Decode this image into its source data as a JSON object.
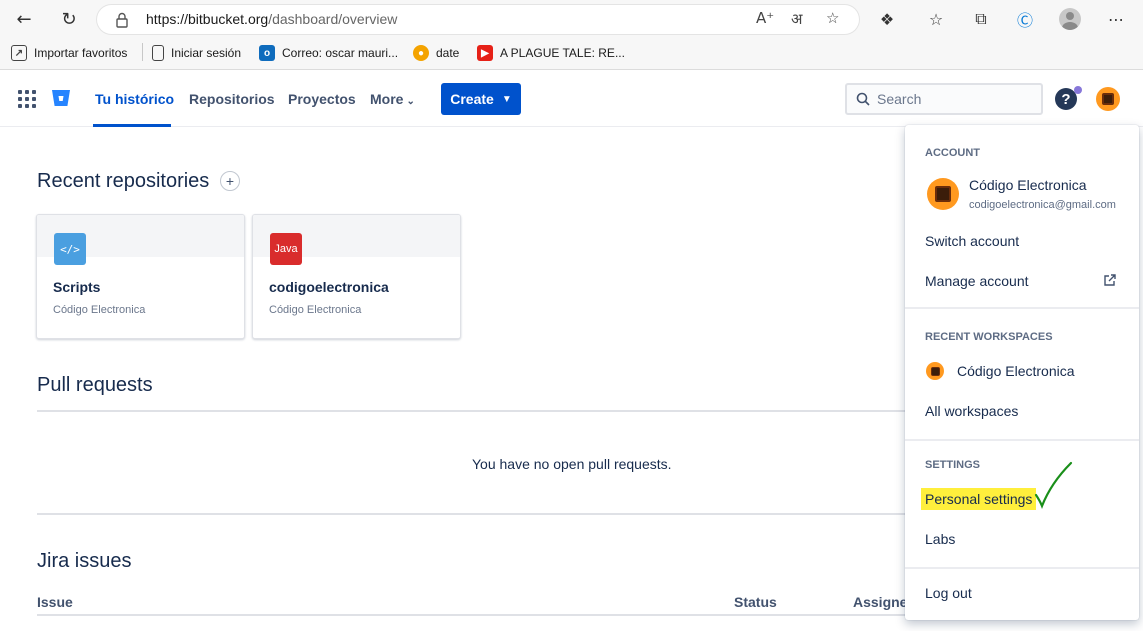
{
  "browser": {
    "url_main": "https://bitbucket.org",
    "url_path": "/dashboard/overview",
    "bookmarks": [
      {
        "label": "Importar favoritos",
        "icon": "import-icon"
      },
      {
        "label": "Iniciar sesión",
        "icon": "page-icon"
      },
      {
        "label": "Correo: oscar mauri...",
        "icon": "outlook-icon"
      },
      {
        "label": "date",
        "icon": "badge-icon"
      },
      {
        "label": "A PLAGUE TALE: RE...",
        "icon": "youtube-icon"
      }
    ]
  },
  "header": {
    "nav": [
      "Tu histórico",
      "Repositorios",
      "Proyectos",
      "More"
    ],
    "create_label": "Create",
    "search_placeholder": "Search",
    "help_label": "?"
  },
  "main": {
    "recent_title": "Recent repositories",
    "add_symbol": "+",
    "repos": [
      {
        "name": "Scripts",
        "owner": "Código Electronica",
        "icon_text": "</>",
        "icon_color": "#4a9fe0"
      },
      {
        "name": "codigoelectronica",
        "owner": "Código Electronica",
        "icon_text": "Java",
        "icon_color": "#d92c2c"
      }
    ],
    "pull_title": "Pull requests",
    "pull_empty": "You have no open pull requests.",
    "jira_title": "Jira issues",
    "jira_columns": [
      "Issue",
      "Status",
      "Assigne"
    ]
  },
  "dropdown": {
    "account_heading": "ACCOUNT",
    "account_name": "Código Electronica",
    "account_email": "codigoelectronica@gmail.com",
    "switch_account": "Switch account",
    "manage_account": "Manage account",
    "recent_heading": "RECENT WORKSPACES",
    "workspace_name": "Código Electronica",
    "all_workspaces": "All workspaces",
    "settings_heading": "SETTINGS",
    "personal_settings": "Personal settings",
    "labs": "Labs",
    "logout": "Log out"
  },
  "colors": {
    "brand": "#0052cc",
    "highlight": "#ffef3c",
    "checkmark": "#1a8f1a"
  }
}
